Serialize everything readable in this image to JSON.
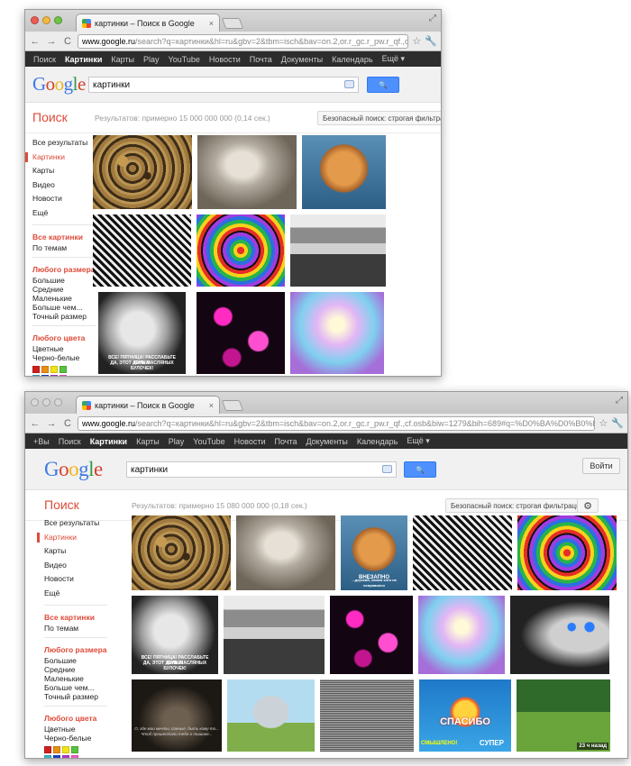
{
  "browser": {
    "tab_title": "картинки – Поиск в Google",
    "tab_close": "×",
    "back": "←",
    "forward": "→",
    "reload": "C",
    "star": "☆",
    "wrench": "🔧",
    "resize": "⤢"
  },
  "window1": {
    "url_host": "www.google.ru",
    "url_rest": "/search?q=картинки&hl=ru&gbv=2&tbm=isch&bav=on.2,or.r_gc.r_pw.r_qf.,cf.osb&biw=127…",
    "gbar": [
      "Поиск",
      "Картинки",
      "Карты",
      "Play",
      "YouTube",
      "Новости",
      "Почта",
      "Документы",
      "Календарь",
      "Ещё ▾"
    ],
    "results_stats": "Результатов: примерно 15 000 000 000 (0,14 сек.)"
  },
  "window2": {
    "url_host": "www.google.ru",
    "url_rest": "/search?q=картинки&hl=ru&gbv=2&tbm=isch&bav=on.2,or.r_gc.r_pw.r_qf.,cf.osb&biw=1279&bih=689#q=%D0%BA%D0%B0%D1%80%D1%82%D0%B8%D0%...",
    "gbar": [
      "+Вы",
      "Поиск",
      "Картинки",
      "Карты",
      "Play",
      "YouTube",
      "Новости",
      "Почта",
      "Документы",
      "Календарь",
      "Ещё ▾"
    ],
    "results_stats": "Результатов: примерно 15 080 000 000 (0,18 сек.)",
    "signin": "Войти",
    "gear": "⚙"
  },
  "search": {
    "query": "картинки",
    "button_icon": "🔍",
    "title": "Поиск",
    "safesearch": "Безопасный поиск: строгая фильтрация ▾"
  },
  "sidebar": {
    "types": [
      "Все результаты",
      "Картинки",
      "Карты",
      "Видео",
      "Новости",
      "Ещё"
    ],
    "all_images": "Все картинки",
    "by_topic": "По темам",
    "size_header": "Любого размера",
    "sizes": [
      "Большие",
      "Средние",
      "Маленькие",
      "Больше чем...",
      "Точный размер"
    ],
    "color_header": "Любого цвета",
    "color_options": [
      "Цветные",
      "Черно-белые"
    ],
    "swatch_colors": [
      "#d0211e",
      "#e98f13",
      "#f4e218",
      "#57c23f",
      "#35b6c8",
      "#1741c9",
      "#b236c4",
      "#f45ac5",
      "#ffffff",
      "#8a8a8a",
      "#000000",
      "#7a4a1c"
    ]
  },
  "captions": {
    "kitten": "ВНЕЗАПНО",
    "kitten_sub": "...дерзкий, своим кота на исправился",
    "baby": "ВСЕ! ПЯТНИЦА! РАССЛАБЬТЕ БУЛКИ!",
    "baby_sub": "ДА, ЭТОТ ДЕНЬ МАСЛЯНЫХ БУЛОЧЕК!",
    "spasibo1": "СПАСИБО",
    "spasibo2": "СУПЕР",
    "spasibo3": "СМЫШЛЕНО!",
    "poem": "О, где мои мечты, сонные, быть кому-то... Чтоб прошептали тебе о тишине...",
    "time_badge": "23 ч назад"
  }
}
